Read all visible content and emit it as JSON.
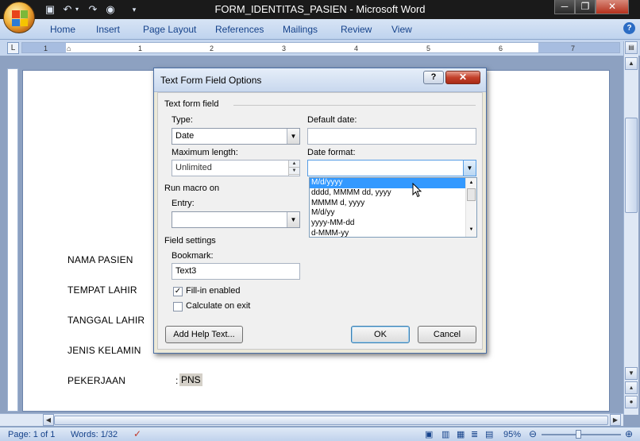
{
  "window": {
    "title": "FORM_IDENTITAS_PASIEN - Microsoft Word",
    "minimize": "─",
    "restore": "❐",
    "close": "✕"
  },
  "ribbon": {
    "tabs": [
      "Home",
      "Insert",
      "Page Layout",
      "References",
      "Mailings",
      "Review",
      "View"
    ],
    "help": "?"
  },
  "ruler": {
    "numbers": [
      "1",
      "1",
      "2",
      "3",
      "4",
      "5",
      "6",
      "7"
    ]
  },
  "document": {
    "fields": [
      {
        "label": "NAMA PASIEN"
      },
      {
        "label": "TEMPAT LAHIR"
      },
      {
        "label": "TANGGAL LAHIR"
      },
      {
        "label": "JENIS KELAMIN"
      },
      {
        "label": "PEKERJAAN",
        "colon": ":",
        "value": "PNS"
      }
    ]
  },
  "dialog": {
    "title": "Text Form Field Options",
    "help": "?",
    "close": "✕",
    "group_text_form_field": "Text form field",
    "type_label": "Type:",
    "type_value": "Date",
    "default_date_label": "Default date:",
    "default_date_value": "",
    "max_length_label": "Maximum length:",
    "max_length_value": "Unlimited",
    "date_format_label": "Date format:",
    "date_format_value": "",
    "date_format_options": [
      "M/d/yyyy",
      "dddd, MMMM dd, yyyy",
      "MMMM d, yyyy",
      "M/d/yy",
      "yyyy-MM-dd",
      "d-MMM-yy"
    ],
    "selected_option": "M/d/yyyy",
    "run_macro_label": "Run macro on",
    "entry_label": "Entry:",
    "entry_value": "",
    "field_settings_label": "Field settings",
    "bookmark_label": "Bookmark:",
    "bookmark_value": "Text3",
    "fill_in_label": "Fill-in enabled",
    "fill_in_checked": true,
    "calculate_label": "Calculate on exit",
    "calculate_checked": false,
    "add_help_label": "Add Help Text...",
    "ok_label": "OK",
    "cancel_label": "Cancel"
  },
  "statusbar": {
    "page": "Page: 1 of 1",
    "words": "Words: 1/32",
    "zoom": "95%"
  },
  "colors": {
    "titlebar": "#1a1a1a",
    "ribbon": "#c9daf0",
    "selection": "#3399ff",
    "dialog_close": "#c3412b"
  }
}
